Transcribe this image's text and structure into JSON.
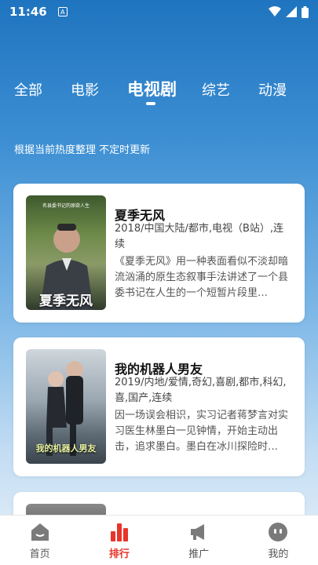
{
  "status_bar": {
    "time": "11:46"
  },
  "tabs": [
    {
      "label": "全部"
    },
    {
      "label": "电影"
    },
    {
      "label": "电视剧"
    },
    {
      "label": "综艺"
    },
    {
      "label": "动漫"
    }
  ],
  "subtitle": "根据当前热度整理 不定时更新",
  "items": [
    {
      "title": "夏季无风",
      "meta": "2018/中国大陆/都市,电视（B站）,连续",
      "desc": "《夏季无风》用一种表面看似不淡却暗流汹涌的原生态叙事手法讲述了一个县委书记在人生的一个短暂片段里…",
      "poster_text": "夏季无风",
      "poster_subtext": "名县委书记的原欲人生"
    },
    {
      "title": "我的机器人男友",
      "meta": "2019/内地/爱情,奇幻,喜剧,都市,科幻,喜,国产,连续",
      "desc": "因一场误会相识，实习记者蒋梦言对实习医生林墨白一见钟情，开始主动出击，追求墨白。墨白在冰川探险时…",
      "poster_text": "我的机器人男友"
    }
  ],
  "bottom_nav": [
    {
      "label": "首页",
      "icon": "home-icon"
    },
    {
      "label": "排行",
      "icon": "ranking-bars-icon"
    },
    {
      "label": "推广",
      "icon": "megaphone-icon"
    },
    {
      "label": "我的",
      "icon": "profile-face-icon"
    }
  ],
  "colors": {
    "accent": "#e8342a",
    "header_top": "#1f74bf"
  }
}
